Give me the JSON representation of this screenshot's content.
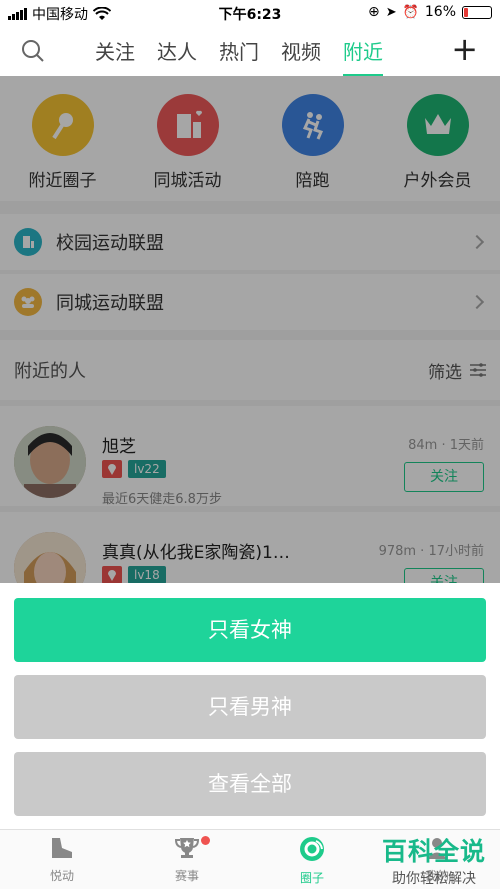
{
  "status": {
    "carrier": "中国移动",
    "time": "下午6:23",
    "battery": "16%",
    "battery_level": 0.16
  },
  "nav": {
    "tabs": [
      "关注",
      "达人",
      "热门",
      "视频",
      "附近"
    ],
    "active_tab": "附近",
    "search_icon": "search-icon",
    "add_icon": "plus-icon",
    "plus": "+"
  },
  "quick": {
    "items": [
      {
        "label": "附近圈子",
        "color": "#f6c433",
        "icon": "map-pin-icon"
      },
      {
        "label": "同城活动",
        "color": "#ef5a5a",
        "icon": "building-heart-icon"
      },
      {
        "label": "陪跑",
        "color": "#3f84e5",
        "icon": "runners-icon"
      },
      {
        "label": "户外会员",
        "color": "#1eb573",
        "icon": "crown-icon"
      }
    ]
  },
  "alliances": [
    {
      "label": "校园运动联盟",
      "color": "#2bb5c8",
      "icon": "campus-icon"
    },
    {
      "label": "同城运动联盟",
      "color": "#f4b942",
      "icon": "group-icon"
    }
  ],
  "people": {
    "header": "附近的人",
    "filter": "筛选",
    "list": [
      {
        "name": "旭芝",
        "level": "lv22",
        "distance_time": "84m · 1天前",
        "sub": "最近6天健走6.8万步",
        "follow": "关注"
      },
      {
        "name": "真真(从化我E家陶瓷)1…",
        "level": "lv18",
        "distance_time": "978m · 17小时前",
        "sub": "",
        "follow": "关注"
      }
    ]
  },
  "sheet": {
    "option_female": "只看女神",
    "option_male": "只看男神",
    "option_all": "查看全部"
  },
  "tabbar": {
    "items": [
      {
        "label": "悦动",
        "icon": "shoe-icon"
      },
      {
        "label": "赛事",
        "icon": "trophy-icon"
      },
      {
        "label": "圈子",
        "icon": "circle-icon"
      },
      {
        "label": "我的",
        "icon": "user-icon"
      }
    ],
    "active": "圈子"
  },
  "watermark": {
    "title": "百科全说",
    "subtitle": "助你轻松解决"
  }
}
